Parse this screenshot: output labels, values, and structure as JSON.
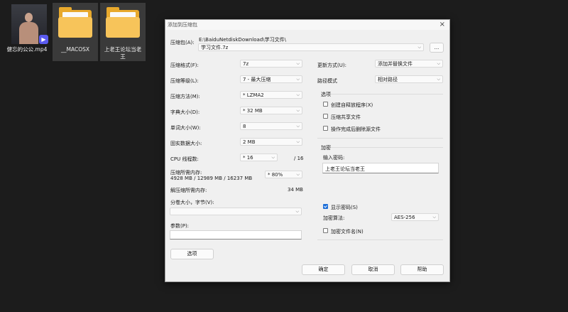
{
  "desktop": {
    "icons": [
      {
        "label": "健忘的公公.mp4",
        "type": "video"
      },
      {
        "label": "__MACOSX",
        "type": "folder"
      },
      {
        "label": "上老王论坛当老王",
        "type": "folder"
      }
    ]
  },
  "dialog": {
    "title": "添加到压缩包",
    "archive_label": "压缩包(A):",
    "archive_path": "E:\\BaiduNetdiskDownload\\学习文件\\",
    "archive_name": "学习文件.7z",
    "browse_label": "...",
    "left": {
      "format": {
        "label": "压缩格式(F):",
        "value": "7z"
      },
      "level": {
        "label": "压缩等级(L):",
        "value": "7 - 最大压缩"
      },
      "method": {
        "label": "压缩方法(M):",
        "value": "* LZMA2"
      },
      "dict": {
        "label": "字典大小(D):",
        "value": "* 32 MB"
      },
      "word": {
        "label": "单词大小(W):",
        "value": "8"
      },
      "solid": {
        "label": "固实数据大小:",
        "value": "2 MB"
      },
      "cpu": {
        "label": "CPU 线程数:",
        "value": "* 16",
        "max": "/ 16"
      },
      "mem_compress": {
        "label": "压缩所需内存:",
        "detail": "4928 MB / 12989 MB / 16237 MB",
        "value": "* 80%"
      },
      "mem_decompress": {
        "label": "解压缩所需内存:",
        "value": "34 MB"
      },
      "split": {
        "label": "分卷大小，字节(V):",
        "value": ""
      },
      "params": {
        "label": "参数(P):",
        "value": ""
      },
      "options_button": "选项"
    },
    "right": {
      "update": {
        "label": "更新方式(U):",
        "value": "添加并替换文件"
      },
      "path": {
        "label": "路径模式",
        "value": "相对路径"
      },
      "options_group": "选项",
      "opt_sfx": "创建自释放程序(X)",
      "opt_shared": "压缩共享文件",
      "opt_delete": "操作完成后删除源文件",
      "encrypt_group": "加密",
      "password_label": "输入密码:",
      "password_value": "上老王论坛当老王",
      "show_password": "显示密码(S)",
      "enc_method_label": "加密算法:",
      "enc_method_value": "AES-256",
      "enc_filenames": "加密文件名(N)"
    },
    "buttons": {
      "ok": "确定",
      "cancel": "取消",
      "help": "帮助"
    }
  }
}
